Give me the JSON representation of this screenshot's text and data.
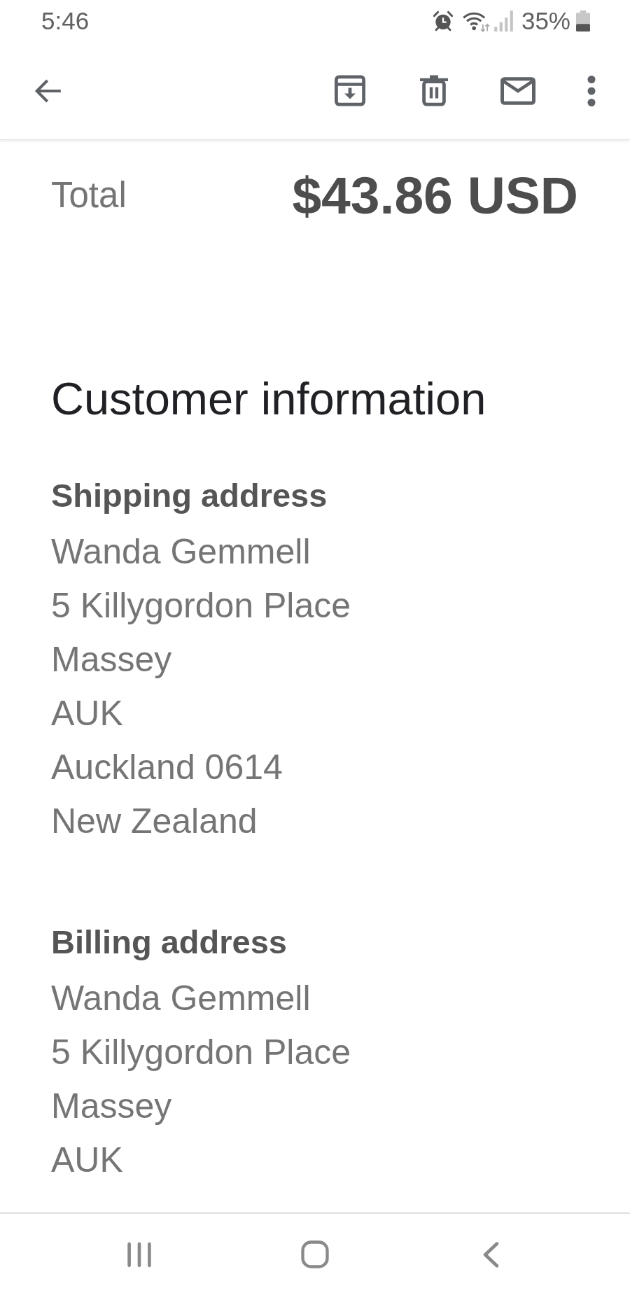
{
  "status_bar": {
    "time": "5:46",
    "battery": "35%"
  },
  "total": {
    "label": "Total",
    "amount": "$43.86 USD"
  },
  "customer_information": {
    "title": "Customer information",
    "sections": [
      {
        "heading": "Shipping address",
        "lines": [
          "Wanda Gemmell",
          "5 Killygordon Place",
          "Massey",
          "AUK",
          "Auckland 0614",
          "New Zealand"
        ]
      },
      {
        "heading": "Billing address",
        "lines": [
          "Wanda Gemmell",
          "5 Killygordon Place",
          "Massey",
          "AUK"
        ]
      }
    ]
  }
}
